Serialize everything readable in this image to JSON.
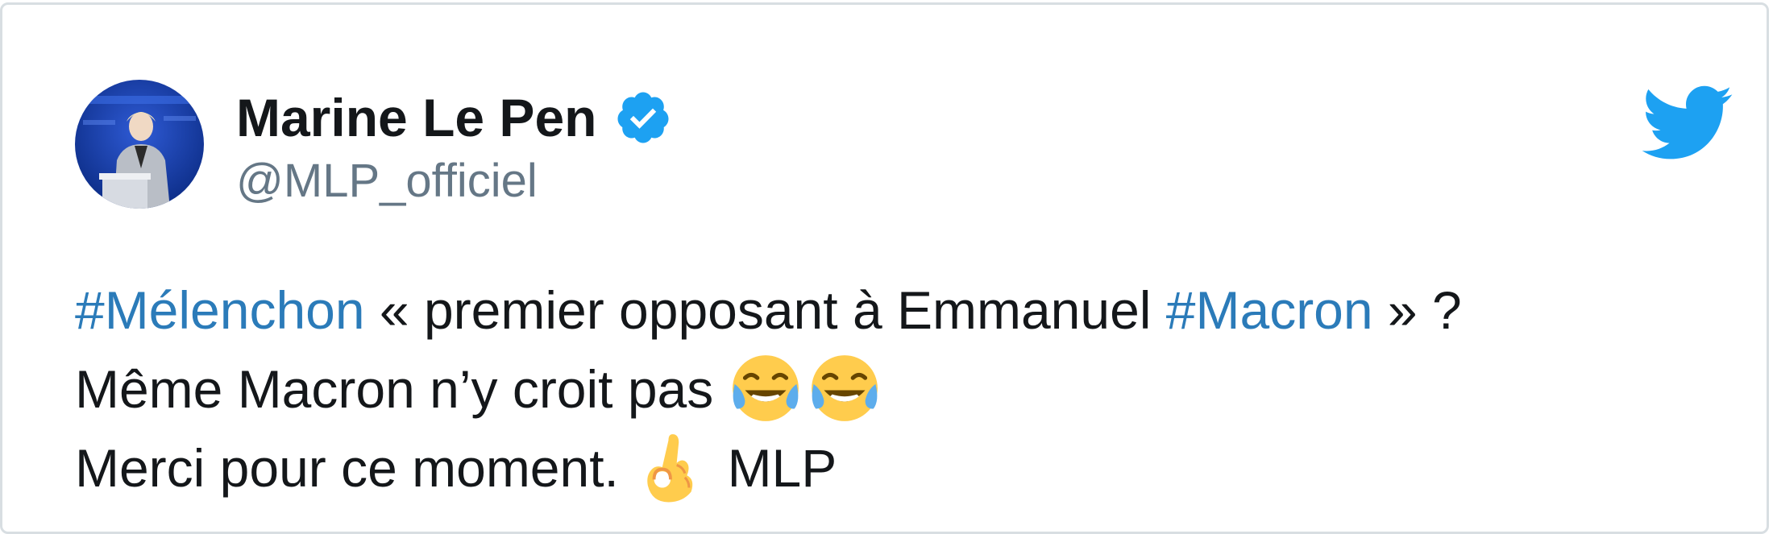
{
  "tweet": {
    "author": {
      "display_name": "Marine Le Pen",
      "handle": "@MLP_officiel",
      "verified": true,
      "avatar_icon": "avatar-photo"
    },
    "lines": [
      {
        "segments": [
          {
            "text": "#Mélenchon",
            "type": "hashtag"
          },
          {
            "text": " « premier opposant à Emmanuel ",
            "type": "text"
          },
          {
            "text": "#Macron",
            "type": "hashtag"
          },
          {
            "text": " » ?",
            "type": "text"
          }
        ]
      },
      {
        "segments": [
          {
            "text": "Même Macron n’y croit pas ",
            "type": "text"
          },
          {
            "emoji": "😂",
            "type": "emoji"
          },
          {
            "emoji": "😂",
            "type": "emoji"
          }
        ]
      },
      {
        "segments": [
          {
            "text": "Merci pour ce moment. ",
            "type": "text"
          },
          {
            "emoji": "👌",
            "type": "emoji"
          },
          {
            "text": " MLP",
            "type": "text"
          }
        ]
      }
    ],
    "icons": {
      "brand": "twitter-bird-icon",
      "verified": "verified-badge-icon"
    },
    "colors": {
      "hashtag": "#2b7bb9",
      "verified": "#1da1f2",
      "twitter_brand": "#1da1f2",
      "text": "#14171a",
      "handle": "#657786"
    }
  }
}
